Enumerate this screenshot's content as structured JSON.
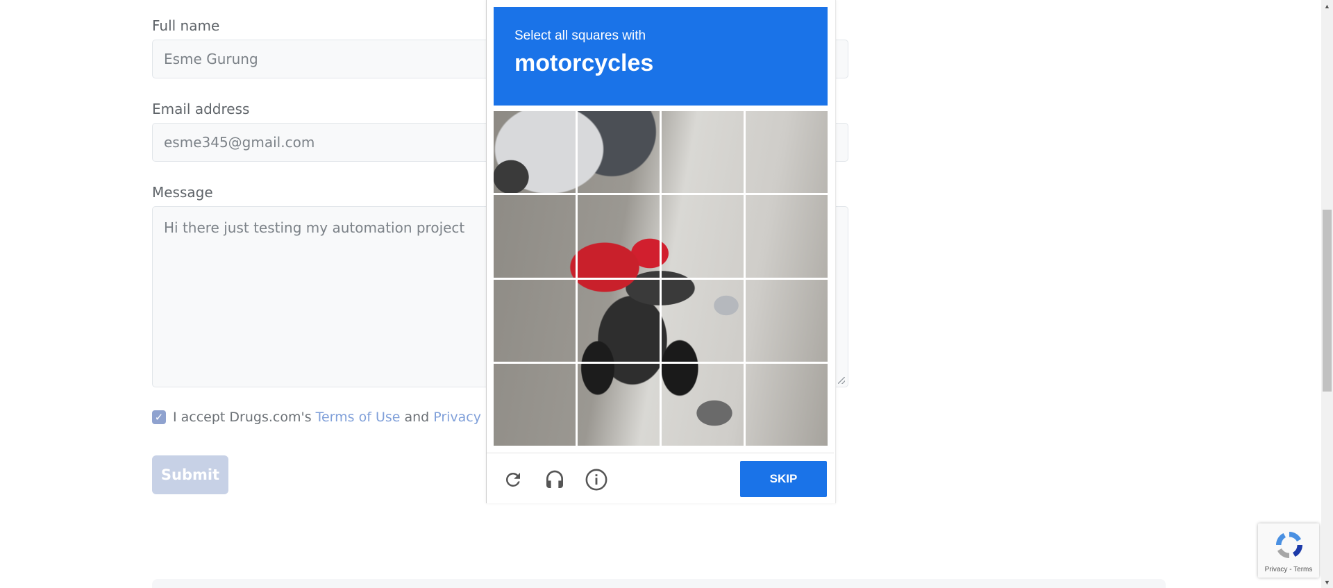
{
  "form": {
    "full_name_label": "Full name",
    "full_name_value": "Esme Gurung",
    "email_label": "Email address",
    "email_value": "esme345@gmail.com",
    "message_label": "Message",
    "message_value": "Hi there just testing my automation project",
    "terms_prefix": "I accept Drugs.com's",
    "terms_link": "Terms of Use",
    "terms_and": "and",
    "privacy_link": "Privacy Policy",
    "terms_checked": true,
    "submit_label": "Submit"
  },
  "captcha": {
    "instruction": "Select all squares with",
    "target": "motorcycles",
    "grid_rows": 4,
    "grid_cols": 4,
    "skip_label": "SKIP",
    "icons": [
      "reload-icon",
      "audio-icon",
      "info-icon"
    ],
    "accent_color": "#1a73e8"
  },
  "badge": {
    "text": "Privacy - Terms"
  }
}
